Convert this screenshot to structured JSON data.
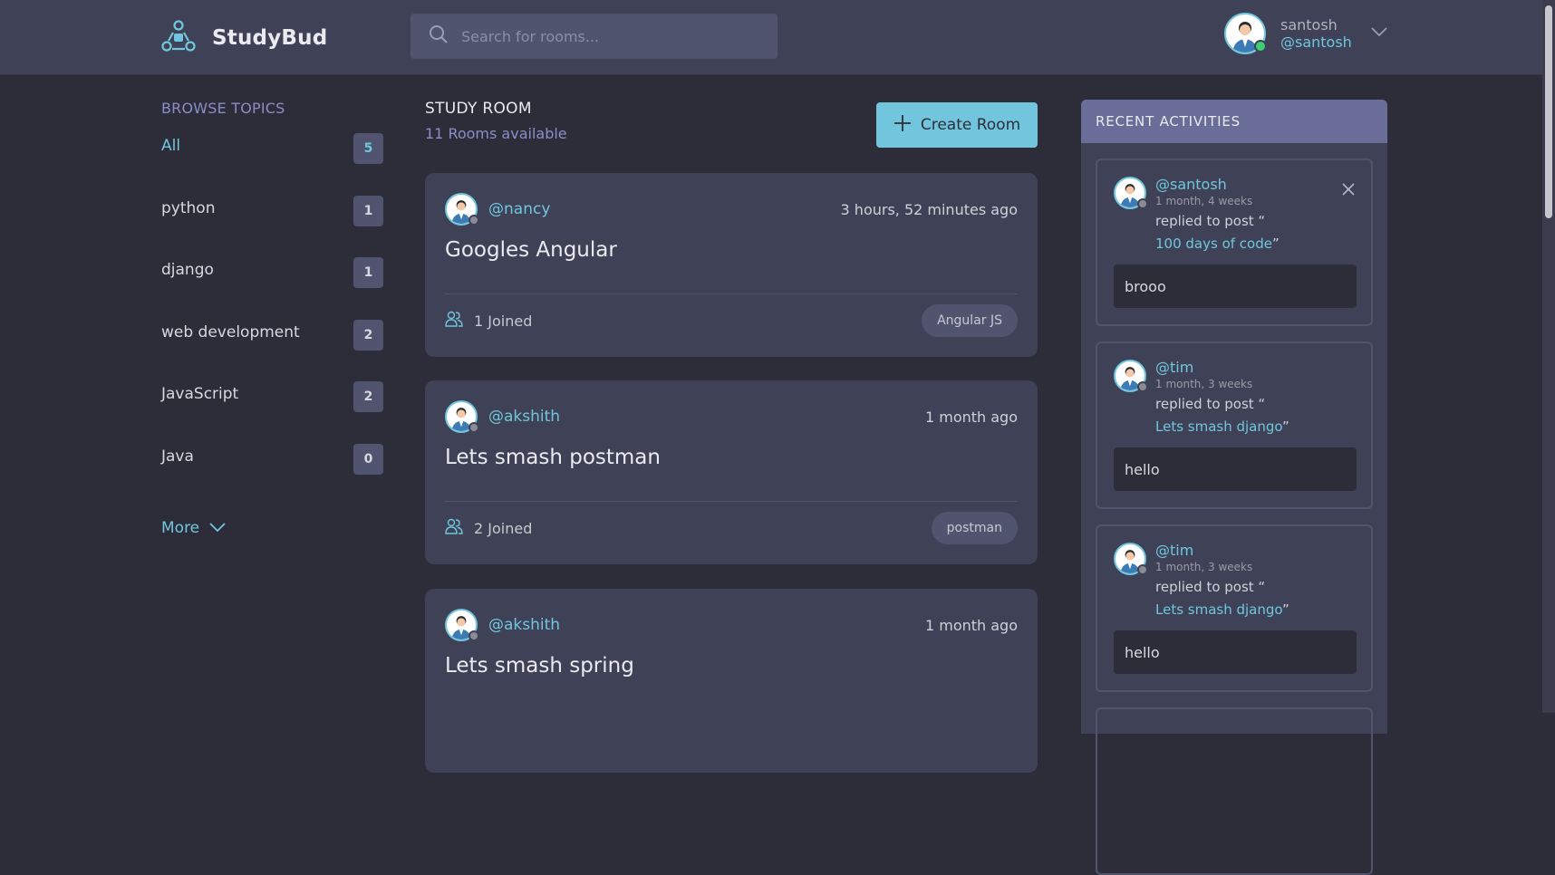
{
  "header": {
    "brand": "StudyBud",
    "search": {
      "placeholder": "Search for rooms..."
    },
    "user": {
      "name": "santosh",
      "handle": "@santosh"
    }
  },
  "sidebar": {
    "title": "BROWSE TOPICS",
    "topics": [
      {
        "label": "All",
        "count": "5"
      },
      {
        "label": "python",
        "count": "1"
      },
      {
        "label": "django",
        "count": "1"
      },
      {
        "label": "web development",
        "count": "2"
      },
      {
        "label": "JavaScript",
        "count": "2"
      },
      {
        "label": "Java",
        "count": "0"
      }
    ],
    "more_label": "More"
  },
  "main": {
    "title": "STUDY ROOM",
    "subtitle": "11 Rooms available",
    "create_label": "Create Room",
    "rooms": [
      {
        "host": "@nancy",
        "time": "3 hours, 52 minutes ago",
        "title": "Googles Angular",
        "joined": "1 Joined",
        "topic": "Angular JS"
      },
      {
        "host": "@akshith",
        "time": "1 month ago",
        "title": "Lets smash postman",
        "joined": "2 Joined",
        "topic": "postman"
      },
      {
        "host": "@akshith",
        "time": "1 month ago",
        "title": "Lets smash spring",
        "joined": "",
        "topic": ""
      }
    ]
  },
  "activities": {
    "title": "RECENT ACTIVITIES",
    "items": [
      {
        "user": "@santosh",
        "time": "1 month, 4 weeks",
        "text": "replied to post “",
        "room": "100 days of code",
        "close_quote": "”",
        "message": "brooo"
      },
      {
        "user": "@tim",
        "time": "1 month, 3 weeks",
        "text": "replied to post “",
        "room": "Lets smash django",
        "close_quote": "”",
        "message": "hello"
      },
      {
        "user": "@tim",
        "time": "1 month, 3 weeks",
        "text": "replied to post “",
        "room": "Lets smash django",
        "close_quote": "”",
        "message": "hello"
      }
    ]
  },
  "colors": {
    "accent": "#71c6dd",
    "background": "#2d2d39",
    "panel": "#3f4156",
    "online": "#3ecf71",
    "offline": "#8b8b95"
  },
  "icons": [
    "logo-icon",
    "search-icon",
    "chevron-down-icon",
    "plus-icon",
    "users-icon",
    "close-icon"
  ]
}
